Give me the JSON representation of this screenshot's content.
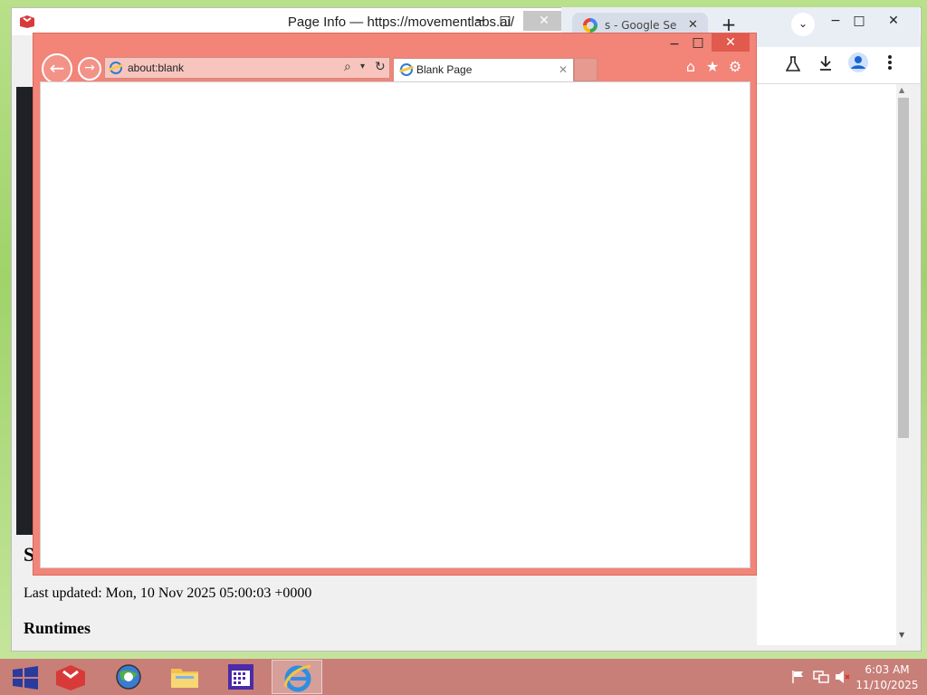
{
  "page_info_window": {
    "title": "Page Info — https://movementlabs.ai/",
    "minimize": "−",
    "maximize": "□",
    "close": "✕"
  },
  "chrome_window": {
    "tab_label": "s - Google Sear",
    "tab_close": "✕",
    "new_tab": "+",
    "tab_search": "⌄",
    "minimize": "−",
    "maximize": "□",
    "close": "✕",
    "toolbar_icons": [
      "labs-flask-icon",
      "download-icon",
      "profile-icon",
      "more-menu-icon"
    ],
    "scroll_up": "▲",
    "scroll_down": "▼"
  },
  "background_page": {
    "heading_fragment": "S",
    "last_updated": "Last updated: Mon, 10 Nov 2025 05:00:03 +0000",
    "section_heading": "Runtimes"
  },
  "ie_window": {
    "minimize": "−",
    "maximize": "□",
    "close": "✕",
    "back": "←",
    "forward": "→",
    "address": "about:blank",
    "search_glyph": "⌕",
    "dropdown_glyph": "▾",
    "refresh_glyph": "↻",
    "tab_title": "Blank Page",
    "tab_close": "✕",
    "home": "⌂",
    "favorites": "★",
    "tools": "⚙",
    "colors": {
      "frame": "#f28478",
      "address_bg": "#f7c5be"
    }
  },
  "taskbar": {
    "items": [
      {
        "name": "start-button",
        "icon": "windows-logo-icon"
      },
      {
        "name": "app-red-box",
        "icon": "red-box-app-icon"
      },
      {
        "name": "app-chrome-like",
        "icon": "globe-app-icon"
      },
      {
        "name": "app-file-explorer",
        "icon": "folder-icon"
      },
      {
        "name": "app-calendar",
        "icon": "calendar-icon"
      },
      {
        "name": "app-internet-explorer",
        "icon": "ie-icon"
      }
    ],
    "tray_icons": [
      "action-center-flag-icon",
      "network-icon",
      "volume-muted-icon"
    ],
    "time": "6:03 AM",
    "date": "11/10/2025"
  }
}
